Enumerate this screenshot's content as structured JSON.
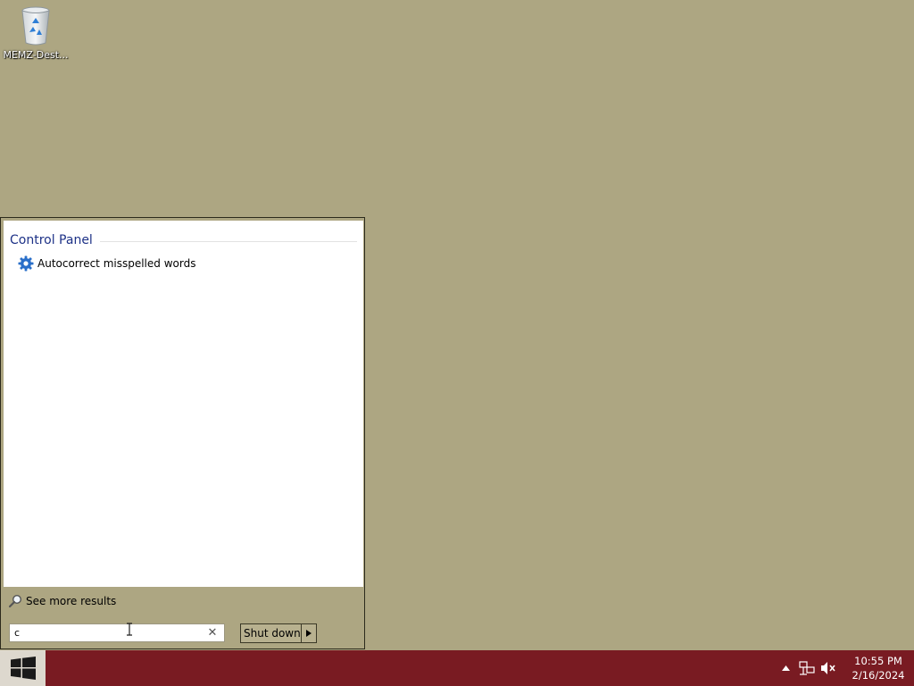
{
  "desktop": {
    "icons": [
      {
        "label": "MEMZ-Dest...",
        "icon": "recycle-bin-icon"
      }
    ],
    "background_color": "#ada682"
  },
  "start_menu": {
    "group_title": "Control Panel",
    "results": [
      {
        "label": "Autocorrect misspelled words",
        "icon": "gear-icon"
      }
    ],
    "see_more_label": "See more results",
    "search": {
      "value": "c",
      "clear_icon": "✕"
    },
    "shutdown_label": "Shut down"
  },
  "taskbar": {
    "color": "#791b22",
    "time": "10:55 PM",
    "date": "2/16/2024",
    "tray_icons": [
      "show-hidden-icons-arrow",
      "network-icon",
      "volume-muted-icon"
    ]
  }
}
